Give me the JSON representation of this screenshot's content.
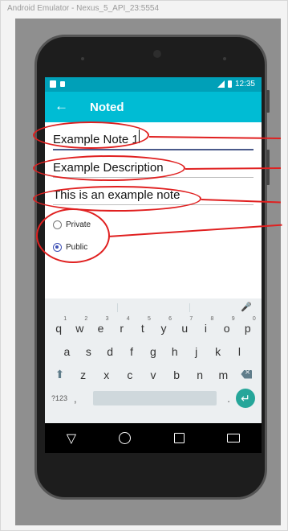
{
  "window": {
    "title": "Android Emulator - Nexus_5_API_23:5554"
  },
  "status_bar": {
    "time": "12:35"
  },
  "app_bar": {
    "title": "Noted"
  },
  "form": {
    "title_value": "Example Note 1",
    "description_value": "Example Description",
    "note_value": "This is an example note",
    "visibility": {
      "options": [
        "Private",
        "Public"
      ],
      "selected": "Public"
    }
  },
  "keyboard": {
    "row1": [
      {
        "key": "q",
        "hint": "1"
      },
      {
        "key": "w",
        "hint": "2"
      },
      {
        "key": "e",
        "hint": "3"
      },
      {
        "key": "r",
        "hint": "4"
      },
      {
        "key": "t",
        "hint": "5"
      },
      {
        "key": "y",
        "hint": "6"
      },
      {
        "key": "u",
        "hint": "7"
      },
      {
        "key": "i",
        "hint": "8"
      },
      {
        "key": "o",
        "hint": "9"
      },
      {
        "key": "p",
        "hint": "0"
      }
    ],
    "row2": [
      "a",
      "s",
      "d",
      "f",
      "g",
      "h",
      "j",
      "k",
      "l"
    ],
    "row3": [
      "z",
      "x",
      "c",
      "v",
      "b",
      "n",
      "m"
    ],
    "symbols_key": "?123",
    "comma_key": ",",
    "period_key": "."
  },
  "colors": {
    "status_bar": "#00a0b8",
    "app_bar": "#00bcd4",
    "annotation": "#e02020",
    "accent": "#3f51b5"
  }
}
